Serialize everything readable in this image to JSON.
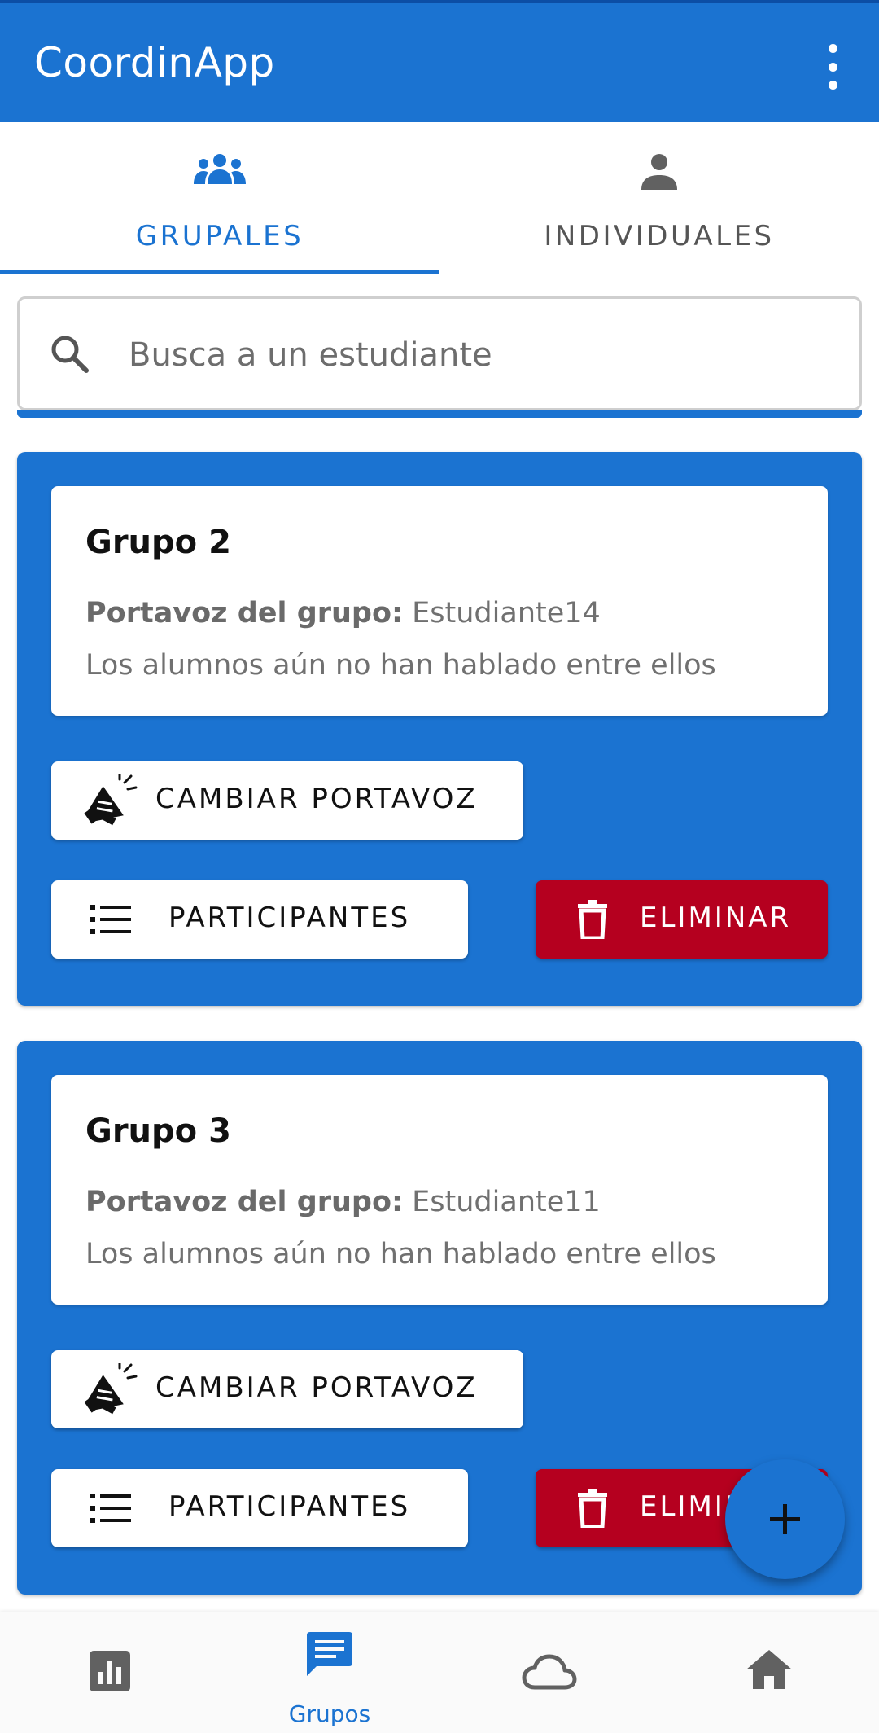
{
  "app": {
    "title": "CoordinApp",
    "accent": "#1b73d1",
    "danger": "#b5001f"
  },
  "header": {
    "overflow_icon": "more-vert-icon"
  },
  "tabs": [
    {
      "label": "GRUPALES",
      "icon": "group-icon",
      "active": true
    },
    {
      "label": "INDIVIDUALES",
      "icon": "person-icon",
      "active": false
    }
  ],
  "search": {
    "placeholder": "Busca a un estudiante",
    "value": "",
    "icon": "search-icon"
  },
  "groups": [
    {
      "title": "Grupo 2",
      "speaker_label": "Portavoz del grupo:",
      "speaker_name": "Estudiante14",
      "status": "Los alumnos aún no han hablado entre ellos",
      "change_speaker_label": "CAMBIAR PORTAVOZ",
      "participants_label": "PARTICIPANTES",
      "delete_label": "ELIMINAR"
    },
    {
      "title": "Grupo 3",
      "speaker_label": "Portavoz del grupo:",
      "speaker_name": "Estudiante11",
      "status": "Los alumnos aún no han hablado entre ellos",
      "change_speaker_label": "CAMBIAR PORTAVOZ",
      "participants_label": "PARTICIPANTES",
      "delete_label": "ELIMINAR"
    }
  ],
  "fab": {
    "icon": "add-icon"
  },
  "bottom_nav": [
    {
      "icon": "bar-chart-icon",
      "label": "",
      "active": false
    },
    {
      "icon": "chat-icon",
      "label": "Grupos",
      "active": true
    },
    {
      "icon": "cloud-icon",
      "label": "",
      "active": false
    },
    {
      "icon": "home-icon",
      "label": "",
      "active": false
    }
  ]
}
